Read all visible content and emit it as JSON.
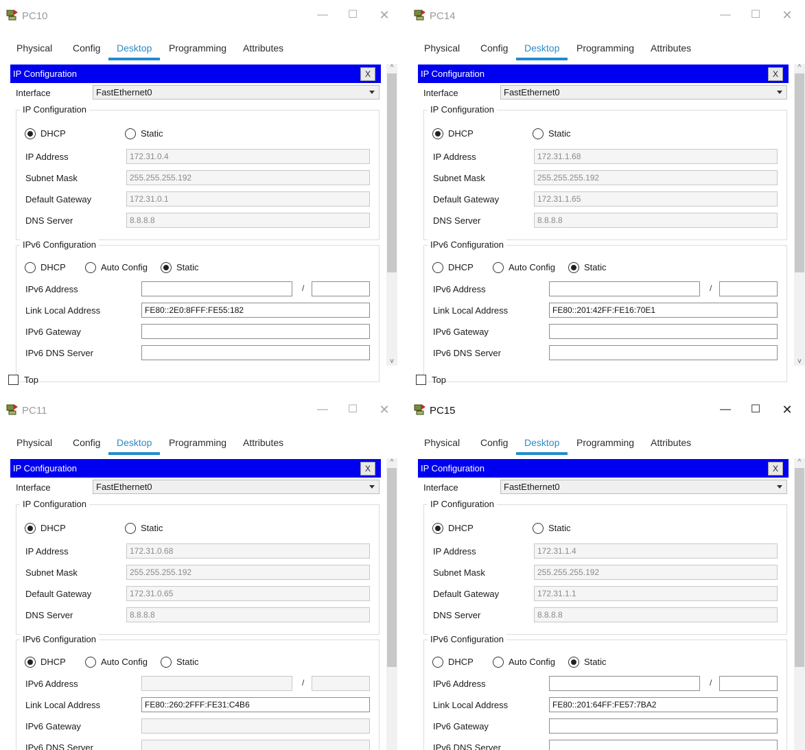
{
  "tabs": [
    "Physical",
    "Config",
    "Desktop",
    "Programming",
    "Attributes"
  ],
  "dialog_title": "IP Configuration",
  "dialog_close": "X",
  "labels": {
    "interface": "Interface",
    "ipv4_group": "IP Configuration",
    "dhcp": "DHCP",
    "static": "Static",
    "auto_config": "Auto Config",
    "ip_address": "IP Address",
    "subnet_mask": "Subnet Mask",
    "default_gateway": "Default Gateway",
    "dns_server": "DNS Server",
    "ipv6_group": "IPv6 Configuration",
    "ipv6_address": "IPv6 Address",
    "link_local": "Link Local Address",
    "ipv6_gateway": "IPv6 Gateway",
    "ipv6_dns": "IPv6 DNS Server",
    "slash": "/",
    "top": "Top"
  },
  "controls": {
    "minimize": "—",
    "maximize": "☐",
    "close": "✕"
  },
  "scroll": {
    "up": "^",
    "down": "v"
  },
  "windows": [
    {
      "title": "PC10",
      "active": false,
      "interface": "FastEthernet0",
      "ipv4_mode": "DHCP",
      "ip": "172.31.0.4",
      "mask": "255.255.255.192",
      "gateway": "172.31.0.1",
      "dns": "8.8.8.8",
      "ipv6_mode": "Static",
      "ipv6_address": "",
      "ipv6_prefix": "",
      "link_local": "FE80::2E0:8FFF:FE55:182",
      "ipv6_gateway": "",
      "ipv6_dns": "",
      "show_top": true
    },
    {
      "title": "PC14",
      "active": false,
      "interface": "FastEthernet0",
      "ipv4_mode": "DHCP",
      "ip": "172.31.1.68",
      "mask": "255.255.255.192",
      "gateway": "172.31.1.65",
      "dns": "8.8.8.8",
      "ipv6_mode": "Static",
      "ipv6_address": "",
      "ipv6_prefix": "",
      "link_local": "FE80::201:42FF:FE16:70E1",
      "ipv6_gateway": "",
      "ipv6_dns": "",
      "show_top": true
    },
    {
      "title": "PC11",
      "active": false,
      "interface": "FastEthernet0",
      "ipv4_mode": "DHCP",
      "ip": "172.31.0.68",
      "mask": "255.255.255.192",
      "gateway": "172.31.0.65",
      "dns": "8.8.8.8",
      "ipv6_mode": "DHCP",
      "ipv6_address": "",
      "ipv6_prefix": "",
      "link_local": "FE80::260:2FFF:FE31:C4B6",
      "ipv6_gateway": "",
      "ipv6_dns": "",
      "show_top": false
    },
    {
      "title": "PC15",
      "active": true,
      "interface": "FastEthernet0",
      "ipv4_mode": "DHCP",
      "ip": "172.31.1.4",
      "mask": "255.255.255.192",
      "gateway": "172.31.1.1",
      "dns": "8.8.8.8",
      "ipv6_mode": "Static",
      "ipv6_address": "",
      "ipv6_prefix": "",
      "link_local": "FE80::201:64FF:FE57:7BA2",
      "ipv6_gateway": "",
      "ipv6_dns": "",
      "show_top": false
    }
  ]
}
